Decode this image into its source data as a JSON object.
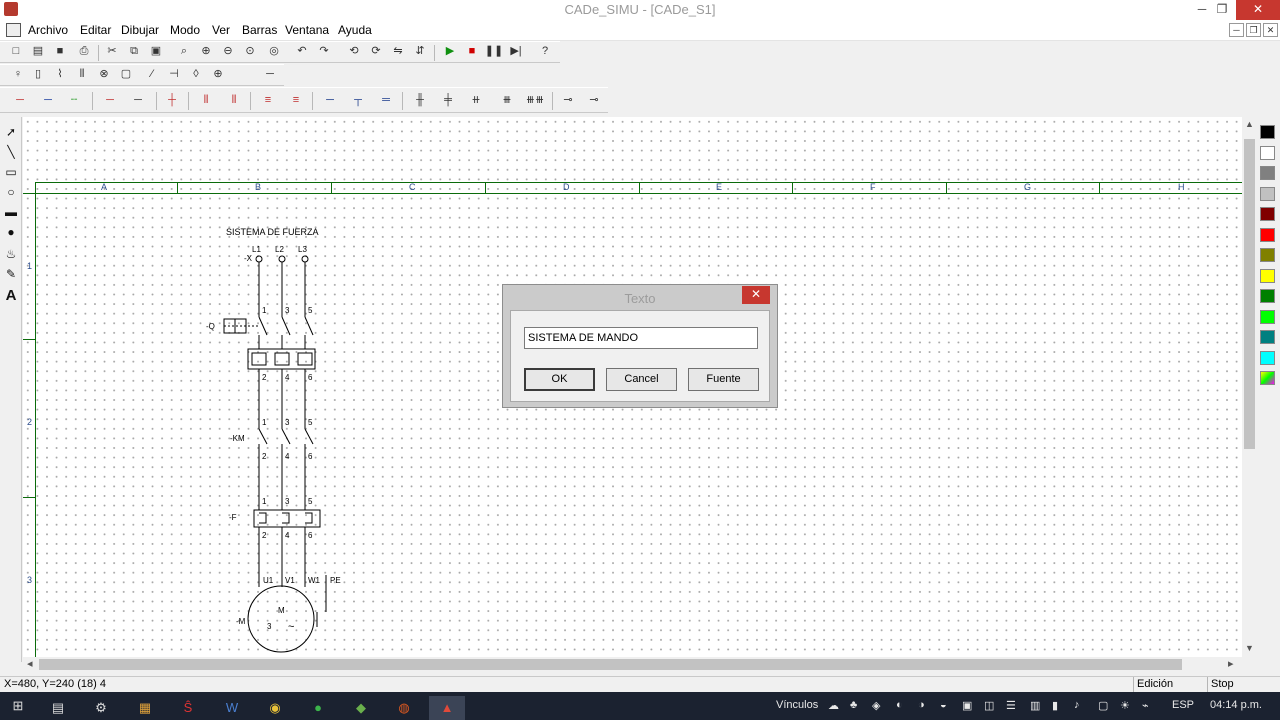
{
  "window": {
    "title": "CADe_SIMU - [CADe_S1]",
    "minimize": "─",
    "restore": "❐",
    "close": "✕"
  },
  "menu": {
    "items": [
      "Archivo",
      "Editar",
      "Dibujar",
      "Modo",
      "Ver",
      "Barras",
      "Ventana",
      "Ayuda"
    ],
    "mdi_minimize": "─",
    "mdi_restore": "❐",
    "mdi_close": "✕"
  },
  "grid": {
    "columns": [
      "A",
      "B",
      "C",
      "D",
      "E",
      "F",
      "G",
      "H"
    ],
    "rows": [
      "1",
      "2",
      "3"
    ]
  },
  "schematic": {
    "title": "SISTEMA DE FUERZA",
    "phases": [
      "L1",
      "L2",
      "L3"
    ],
    "connector_label": "-X",
    "breaker_label": "-Q",
    "contactor_label": "-KM",
    "relay_label": "-F",
    "motor_label": "-M",
    "terminals_top": [
      "1",
      "3",
      "5"
    ],
    "terminals_bottom": [
      "2",
      "4",
      "6"
    ],
    "motor_terminals": [
      "U1",
      "V1",
      "W1",
      "PE"
    ],
    "motor_symbol": "M",
    "motor_phases": "3",
    "motor_ac": "~"
  },
  "dialog": {
    "title": "Texto",
    "close": "✕",
    "input_value": "SISTEMA DE MANDO",
    "ok_label": "OK",
    "cancel_label": "Cancel",
    "font_label": "Fuente"
  },
  "palette": {
    "colors": [
      "#000000",
      "#ffffff",
      "#808080",
      "#c0c0c0",
      "#800000",
      "#ff0000",
      "#808000",
      "#ffff00",
      "#008000",
      "#00ff00",
      "#008080",
      "#00ffff"
    ]
  },
  "status": {
    "coords": "X=480, Y=240 (18) 4",
    "mode": "Edición",
    "sim": "Stop"
  },
  "taskbar": {
    "links_label": "Vínculos",
    "lang": "ESP",
    "time": "04:14 p.m."
  }
}
